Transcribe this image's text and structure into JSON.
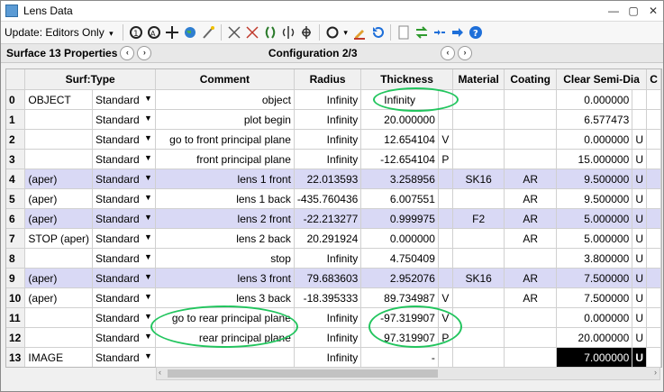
{
  "window": {
    "title": "Lens Data",
    "controls": [
      "—",
      "▢",
      "✕"
    ]
  },
  "toolbar": {
    "update_label": "Update: Editors Only",
    "update_caret": "▾"
  },
  "propbar": {
    "surface_label": "Surface 13 Properties",
    "config_label": "Configuration 2/3",
    "prev": "‹",
    "next": "›"
  },
  "table": {
    "headers": [
      "",
      "Surf:Type",
      "Comment",
      "Radius",
      "Thickness",
      "",
      "Material",
      "Coating",
      "Clear Semi-Dia",
      "",
      "C"
    ],
    "rows": [
      {
        "n": "0",
        "name": "OBJECT",
        "type": "Standard",
        "comment": "object",
        "radius": "Infinity",
        "thick": "Infinity",
        "tflag": "",
        "mat": "",
        "coat": "",
        "csd": "0.000000",
        "cflag": "",
        "aper": false
      },
      {
        "n": "1",
        "name": "",
        "type": "Standard",
        "comment": "plot begin",
        "radius": "Infinity",
        "thick": "20.000000",
        "tflag": "",
        "mat": "",
        "coat": "",
        "csd": "6.577473",
        "cflag": "",
        "aper": false
      },
      {
        "n": "2",
        "name": "",
        "type": "Standard",
        "comment": "go to front principal plane",
        "radius": "Infinity",
        "thick": "12.654104",
        "tflag": "V",
        "mat": "",
        "coat": "",
        "csd": "0.000000",
        "cflag": "U",
        "aper": false
      },
      {
        "n": "3",
        "name": "",
        "type": "Standard",
        "comment": "front principal plane",
        "radius": "Infinity",
        "thick": "-12.654104",
        "tflag": "P",
        "mat": "",
        "coat": "",
        "csd": "15.000000",
        "cflag": "U",
        "aper": false
      },
      {
        "n": "4",
        "name": "(aper)",
        "type": "Standard",
        "comment": "lens 1 front",
        "radius": "22.013593",
        "thick": "3.258956",
        "tflag": "",
        "mat": "SK16",
        "coat": "AR",
        "csd": "9.500000",
        "cflag": "U",
        "aper": true
      },
      {
        "n": "5",
        "name": "(aper)",
        "type": "Standard",
        "comment": "lens 1 back",
        "radius": "-435.760436",
        "thick": "6.007551",
        "tflag": "",
        "mat": "",
        "coat": "AR",
        "csd": "9.500000",
        "cflag": "U",
        "aper": false
      },
      {
        "n": "6",
        "name": "(aper)",
        "type": "Standard",
        "comment": "lens 2 front",
        "radius": "-22.213277",
        "thick": "0.999975",
        "tflag": "",
        "mat": "F2",
        "coat": "AR",
        "csd": "5.000000",
        "cflag": "U",
        "aper": true
      },
      {
        "n": "7",
        "name": "STOP (aper)",
        "type": "Standard",
        "comment": "lens 2 back",
        "radius": "20.291924",
        "thick": "0.000000",
        "tflag": "",
        "mat": "",
        "coat": "AR",
        "csd": "5.000000",
        "cflag": "U",
        "aper": false
      },
      {
        "n": "8",
        "name": "",
        "type": "Standard",
        "comment": "stop",
        "radius": "Infinity",
        "thick": "4.750409",
        "tflag": "",
        "mat": "",
        "coat": "",
        "csd": "3.800000",
        "cflag": "U",
        "aper": false
      },
      {
        "n": "9",
        "name": "(aper)",
        "type": "Standard",
        "comment": "lens 3 front",
        "radius": "79.683603",
        "thick": "2.952076",
        "tflag": "",
        "mat": "SK16",
        "coat": "AR",
        "csd": "7.500000",
        "cflag": "U",
        "aper": true
      },
      {
        "n": "10",
        "name": "(aper)",
        "type": "Standard",
        "comment": "lens 3 back",
        "radius": "-18.395333",
        "thick": "89.734987",
        "tflag": "V",
        "mat": "",
        "coat": "AR",
        "csd": "7.500000",
        "cflag": "U",
        "aper": false
      },
      {
        "n": "11",
        "name": "",
        "type": "Standard",
        "comment": "go to rear principal plane",
        "radius": "Infinity",
        "thick": "-97.319907",
        "tflag": "V",
        "mat": "",
        "coat": "",
        "csd": "0.000000",
        "cflag": "U",
        "aper": false
      },
      {
        "n": "12",
        "name": "",
        "type": "Standard",
        "comment": "rear principal plane",
        "radius": "Infinity",
        "thick": "97.319907",
        "tflag": "P",
        "mat": "",
        "coat": "",
        "csd": "20.000000",
        "cflag": "U",
        "aper": false
      },
      {
        "n": "13",
        "name": "IMAGE",
        "type": "Standard",
        "comment": "",
        "radius": "Infinity",
        "thick": "-",
        "tflag": "",
        "mat": "",
        "coat": "",
        "csd": "7.000000",
        "cflag": "U",
        "aper": false
      }
    ]
  },
  "colors": {
    "aper_row": "#d9d9f5",
    "annotation": "#22c55e",
    "selected": "#000000"
  }
}
